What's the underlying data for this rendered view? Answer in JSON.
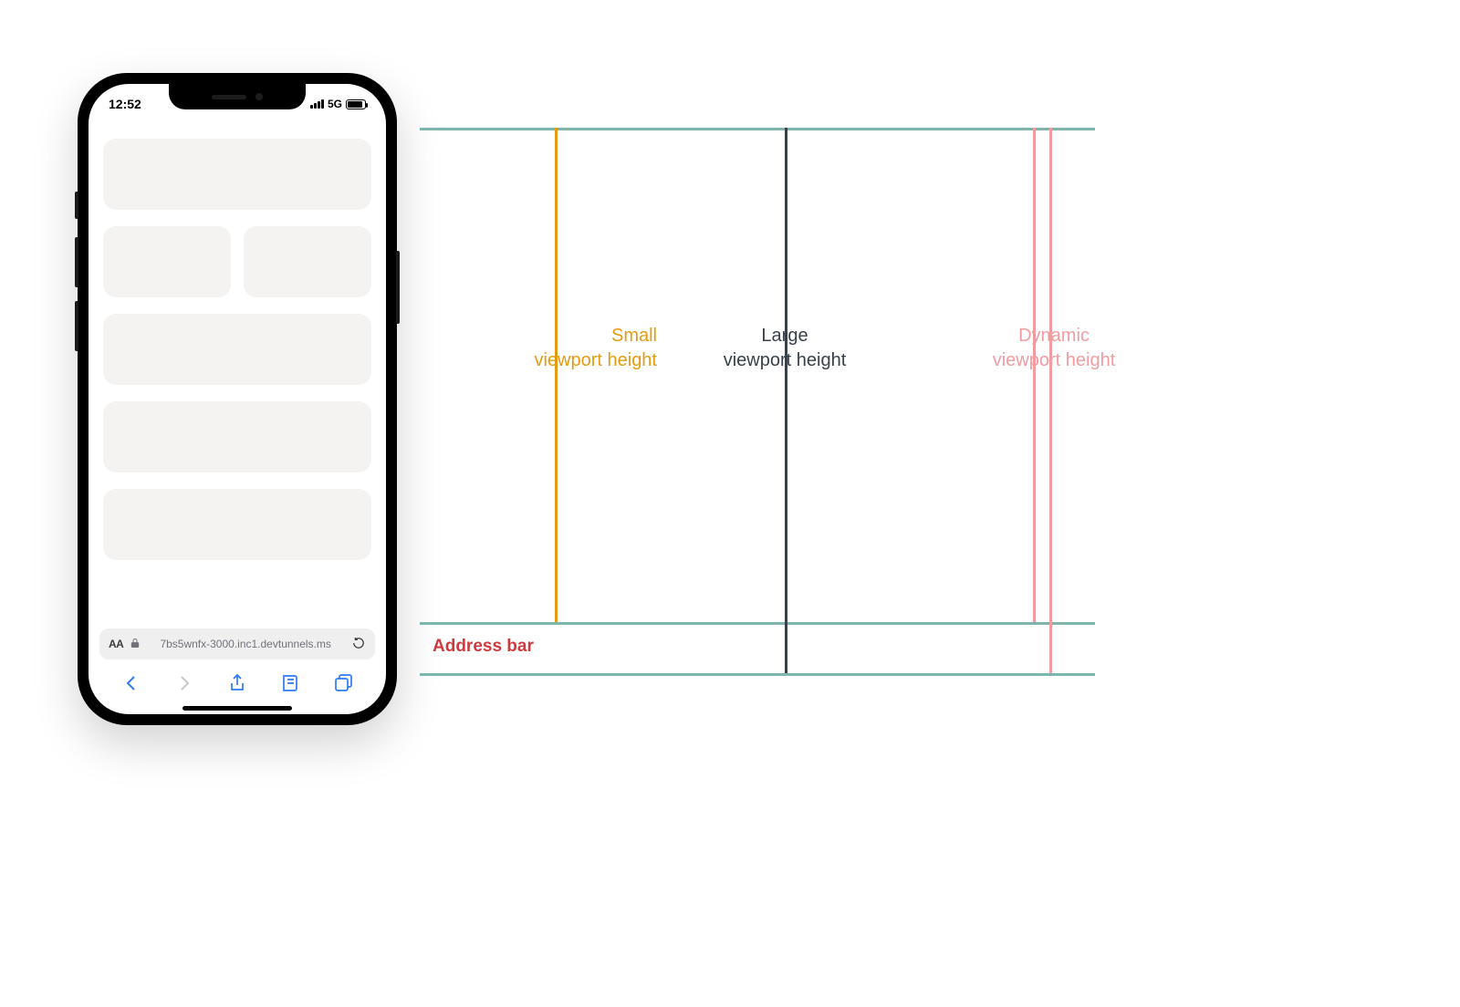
{
  "phone": {
    "status": {
      "time": "12:52",
      "network": "5G"
    },
    "address_bar": {
      "aa": "AA",
      "url": "7bs5wnfx-3000.inc1.devtunnels.ms"
    },
    "toolbar": {
      "back": "Back",
      "forward": "Forward",
      "share": "Share",
      "bookmarks": "Bookmarks",
      "tabs": "Tabs"
    }
  },
  "diagram": {
    "labels": {
      "small_line1": "Small",
      "small_line2": "viewport height",
      "large_line1": "Large",
      "large_line2": "viewport height",
      "dynamic_line1": "Dynamic",
      "dynamic_line2": "viewport height",
      "address_bar": "Address bar"
    },
    "colors": {
      "teal": "#7fb5ac",
      "orange": "#e59b11",
      "dark": "#384049",
      "pink": "#f19ca1",
      "red": "#cf3a3e"
    }
  }
}
